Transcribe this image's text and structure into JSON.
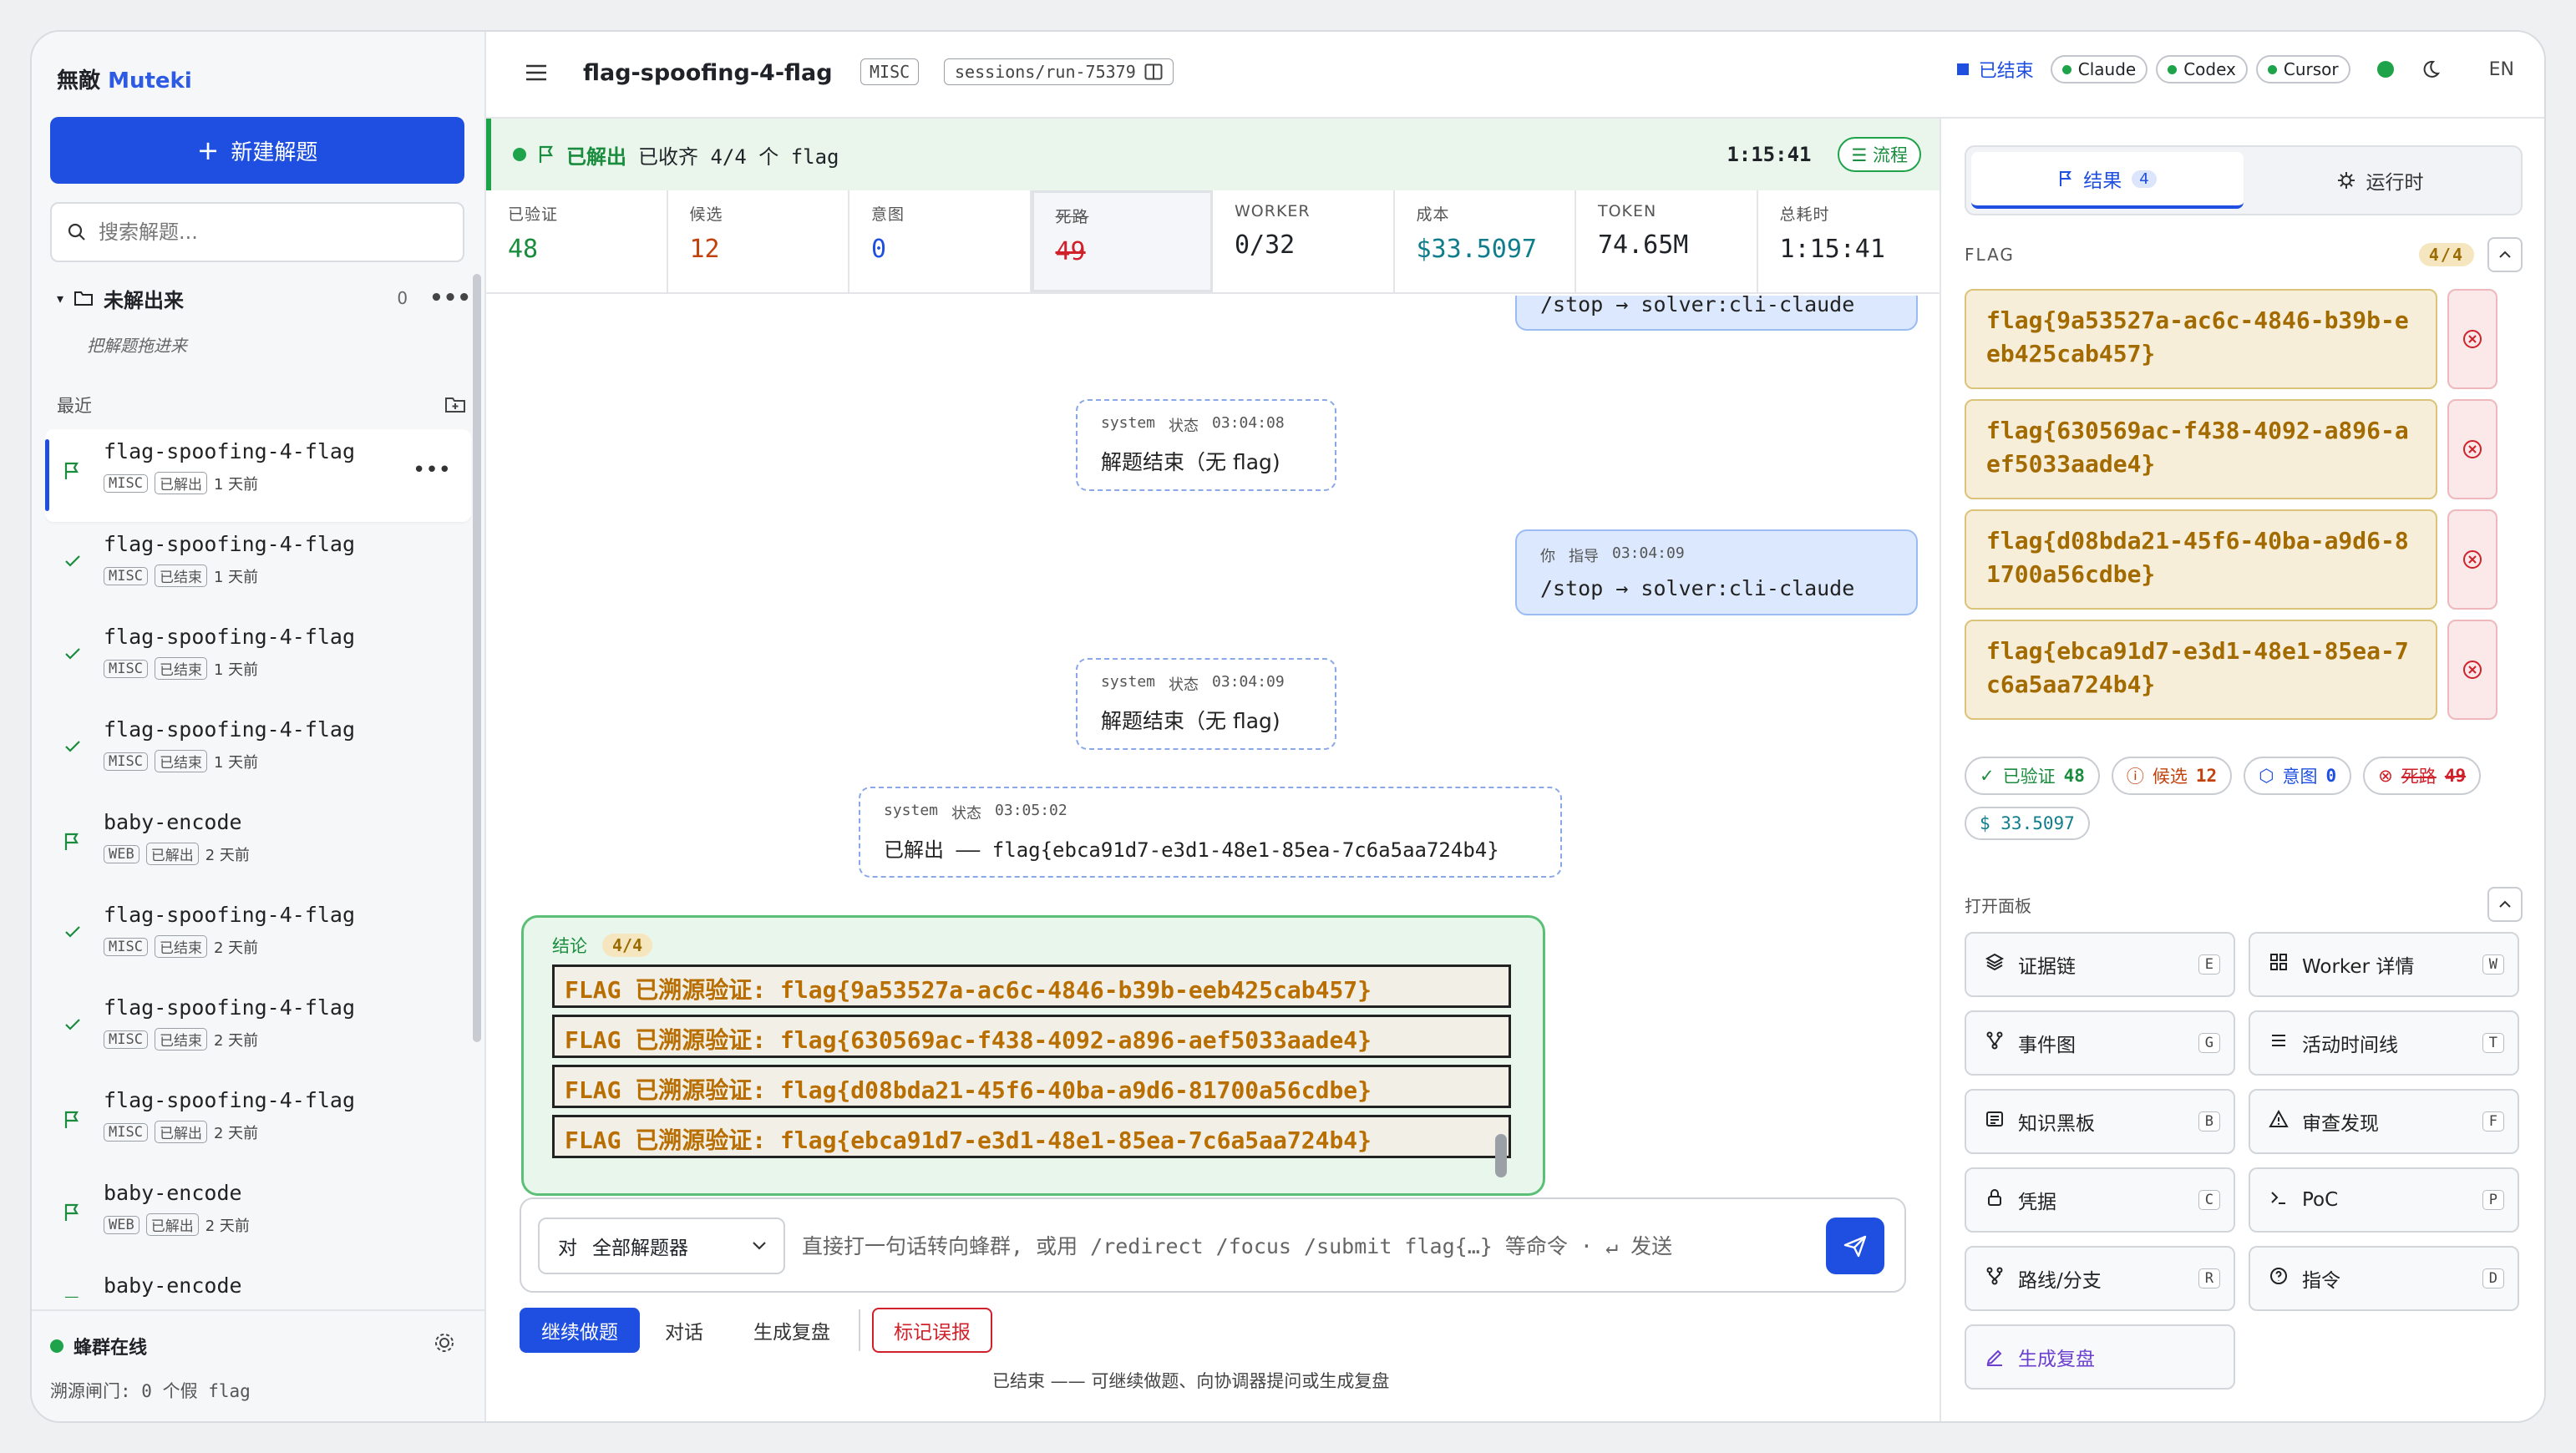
{
  "brand": {
    "name": "無敵",
    "suffix": "Muteki"
  },
  "sidebar": {
    "new_button": "新建解题",
    "search_placeholder": "搜索解题...",
    "folder": {
      "label": "未解出来",
      "count": "0",
      "hint": "把解题拖进来"
    },
    "recent_label": "最近",
    "sessions": [
      {
        "title": "flag-spoofing-4-flag",
        "category": "MISC",
        "status": "已解出",
        "age": "1 天前",
        "icon": "flag-icon"
      },
      {
        "title": "flag-spoofing-4-flag",
        "category": "MISC",
        "status": "已结束",
        "age": "1 天前",
        "icon": "check-icon"
      },
      {
        "title": "flag-spoofing-4-flag",
        "category": "MISC",
        "status": "已结束",
        "age": "1 天前",
        "icon": "check-icon"
      },
      {
        "title": "flag-spoofing-4-flag",
        "category": "MISC",
        "status": "已结束",
        "age": "1 天前",
        "icon": "check-icon"
      },
      {
        "title": "baby-encode",
        "category": "WEB",
        "status": "已解出",
        "age": "2 天前",
        "icon": "flag-icon"
      },
      {
        "title": "flag-spoofing-4-flag",
        "category": "MISC",
        "status": "已结束",
        "age": "2 天前",
        "icon": "check-icon"
      },
      {
        "title": "flag-spoofing-4-flag",
        "category": "MISC",
        "status": "已结束",
        "age": "2 天前",
        "icon": "check-icon"
      },
      {
        "title": "flag-spoofing-4-flag",
        "category": "MISC",
        "status": "已解出",
        "age": "2 天前",
        "icon": "flag-icon"
      },
      {
        "title": "baby-encode",
        "category": "WEB",
        "status": "已解出",
        "age": "2 天前",
        "icon": "flag-icon"
      },
      {
        "title": "baby-encode",
        "category": "",
        "status": "",
        "age": "",
        "icon": "flag-icon"
      }
    ],
    "footer": {
      "swarm_online": "蜂群在线",
      "trace_gate": "溯源闸门: 0 个假 flag"
    }
  },
  "header": {
    "title": "flag-spoofing-4-flag",
    "category": "MISC",
    "session_path": "sessions/run-75379",
    "state": "已结束",
    "agents": [
      "Claude",
      "Codex",
      "Cursor"
    ],
    "lang": "EN"
  },
  "statusbar": {
    "solved": "已解出",
    "summary": "已收齐 4/4 个 flag",
    "elapsed": "1:15:41",
    "flow_button": "流程"
  },
  "metrics": [
    {
      "label": "已验证",
      "value": "48"
    },
    {
      "label": "候选",
      "value": "12"
    },
    {
      "label": "意图",
      "value": "0"
    },
    {
      "label": "死路",
      "value": "49"
    },
    {
      "label": "WORKER",
      "value": "0/32"
    },
    {
      "label": "成本",
      "value": "$33.5097"
    },
    {
      "label": "TOKEN",
      "value": "74.65M"
    },
    {
      "label": "总耗时",
      "value": "1:15:41"
    }
  ],
  "chat": {
    "top_partial": {
      "text": "/stop  → solver:cli-claude"
    },
    "msg1": {
      "role": "system",
      "kind": "状态",
      "time": "03:04:08",
      "text": "解题结束（无 flag)"
    },
    "msg2": {
      "role": "你",
      "kind": "指导",
      "time": "03:04:09",
      "text": "/stop  → solver:cli-claude"
    },
    "msg3": {
      "role": "system",
      "kind": "状态",
      "time": "03:04:09",
      "text": "解题结束（无 flag)"
    },
    "msg4": {
      "role": "system",
      "kind": "状态",
      "time": "03:05:02",
      "text": "已解出 —— flag{ebca91d7-e3d1-48e1-85ea-7c6a5aa724b4}"
    },
    "conclusion": {
      "label": "结论",
      "badge": "4/4",
      "lines": [
        "FLAG 已溯源验证: flag{9a53527a-ac6c-4846-b39b-eeb425cab457}",
        "FLAG 已溯源验证: flag{630569ac-f438-4092-a896-aef5033aade4}",
        "FLAG 已溯源验证: flag{d08bda21-45f6-40ba-a9d6-81700a56cdbe}",
        "FLAG 已溯源验证: flag{ebca91d7-e3d1-48e1-85ea-7c6a5aa724b4}"
      ]
    }
  },
  "composer": {
    "target_prefix": "对",
    "target_value": "全部解题器",
    "placeholder": "直接打一句话转向蜂群, 或用 /redirect /focus /submit flag{…} 等命令 · ↵ 发送"
  },
  "actions": {
    "continue": "继续做题",
    "chat": "对话",
    "review": "生成复盘",
    "mark_false": "标记误报",
    "note": "已结束 —— 可继续做题、向协调器提问或生成复盘"
  },
  "rpanel": {
    "tab_results": "结果",
    "tab_results_count": "4",
    "tab_runtime": "运行时",
    "flag_label": "FLAG",
    "flag_badge": "4/4",
    "flags": [
      "flag{9a53527a-ac6c-4846-b39b-eeb425cab457}",
      "flag{630569ac-f438-4092-a896-aef5033aade4}",
      "flag{d08bda21-45f6-40ba-a9d6-81700a56cdbe}",
      "flag{ebca91d7-e3d1-48e1-85ea-7c6a5aa724b4}"
    ],
    "stats": {
      "verified_label": "已验证",
      "verified": "48",
      "candidate_label": "候选",
      "candidate": "12",
      "intent_label": "意图",
      "intent": "0",
      "dead_label": "死路",
      "dead": "49",
      "cost": "$ 33.5097"
    },
    "panels_label": "打开面板",
    "panels": [
      {
        "label": "证据链",
        "key": "E",
        "icon": "layers-icon"
      },
      {
        "label": "Worker 详情",
        "key": "W",
        "icon": "grid-icon"
      },
      {
        "label": "事件图",
        "key": "G",
        "icon": "branch-icon"
      },
      {
        "label": "活动时间线",
        "key": "T",
        "icon": "list-icon"
      },
      {
        "label": "知识黑板",
        "key": "B",
        "icon": "board-icon"
      },
      {
        "label": "审查发现",
        "key": "F",
        "icon": "warning-icon"
      },
      {
        "label": "凭据",
        "key": "C",
        "icon": "lock-icon"
      },
      {
        "label": "PoC",
        "key": "P",
        "icon": "terminal-icon"
      },
      {
        "label": "路线/分支",
        "key": "R",
        "icon": "fork-icon"
      },
      {
        "label": "指令",
        "key": "D",
        "icon": "help-icon"
      }
    ],
    "review_button": "生成复盘"
  },
  "colors": {
    "accent": "#1e4fe0",
    "success": "#1fa34a",
    "danger": "#d0202a",
    "flag": "#a36a00"
  }
}
